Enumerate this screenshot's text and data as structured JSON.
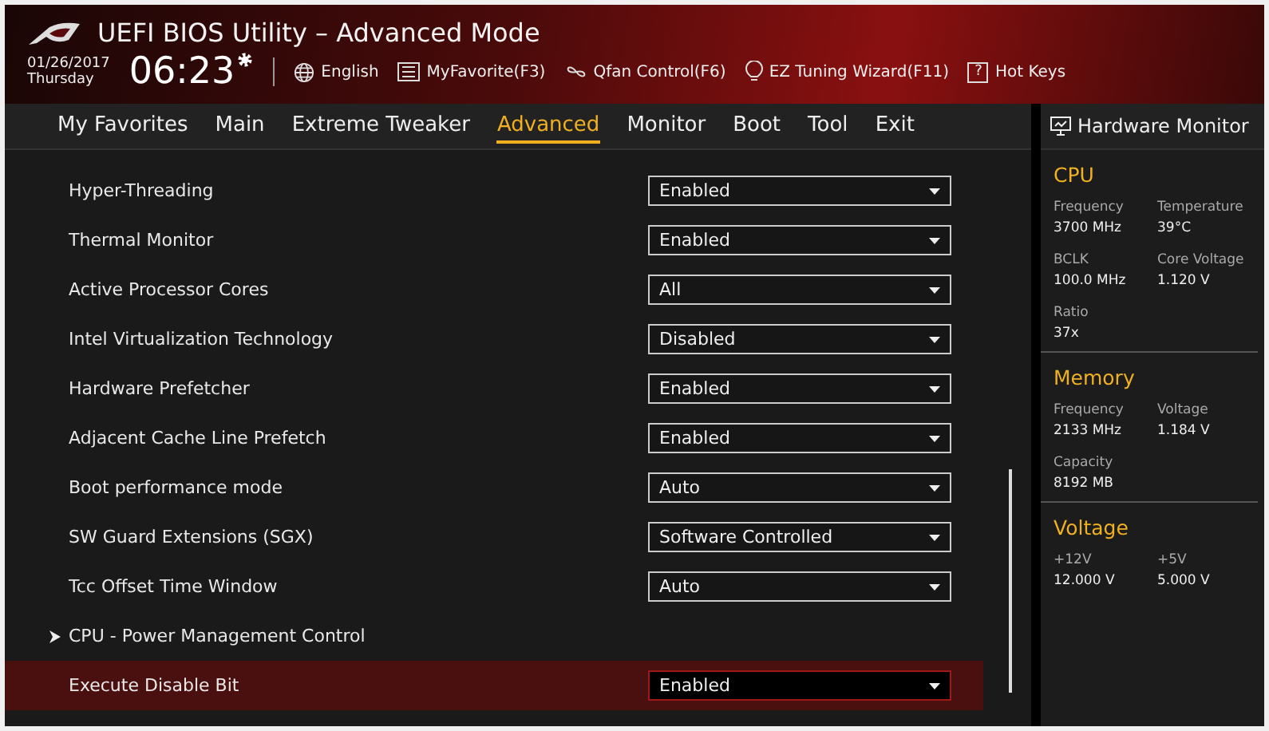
{
  "header": {
    "title": "UEFI BIOS Utility – Advanced Mode",
    "date": "01/26/2017",
    "day": "Thursday",
    "time": "06:23",
    "tools": [
      {
        "kind": "globe",
        "label": "English"
      },
      {
        "kind": "list",
        "label": "MyFavorite(F3)"
      },
      {
        "kind": "fan",
        "label": "Qfan Control(F6)"
      },
      {
        "kind": "bulb",
        "label": "EZ Tuning Wizard(F11)"
      },
      {
        "kind": "help",
        "icon": "?",
        "label": "Hot Keys"
      }
    ]
  },
  "tabs": [
    {
      "label": "My Favorites",
      "selected": false
    },
    {
      "label": "Main",
      "selected": false
    },
    {
      "label": "Extreme Tweaker",
      "selected": false
    },
    {
      "label": "Advanced",
      "selected": true
    },
    {
      "label": "Monitor",
      "selected": false
    },
    {
      "label": "Boot",
      "selected": false
    },
    {
      "label": "Tool",
      "selected": false
    },
    {
      "label": "Exit",
      "selected": false
    }
  ],
  "settings": [
    {
      "kind": "dropdown",
      "label": "Hyper-Threading",
      "value": "Enabled",
      "selected": false
    },
    {
      "kind": "dropdown",
      "label": "Thermal Monitor",
      "value": "Enabled",
      "selected": false
    },
    {
      "kind": "dropdown",
      "label": "Active Processor Cores",
      "value": "All",
      "selected": false
    },
    {
      "kind": "dropdown",
      "label": "Intel Virtualization Technology",
      "value": "Disabled",
      "selected": false
    },
    {
      "kind": "dropdown",
      "label": "Hardware Prefetcher",
      "value": "Enabled",
      "selected": false
    },
    {
      "kind": "dropdown",
      "label": "Adjacent Cache Line Prefetch",
      "value": "Enabled",
      "selected": false
    },
    {
      "kind": "dropdown",
      "label": "Boot performance mode",
      "value": "Auto",
      "selected": false
    },
    {
      "kind": "dropdown",
      "label": "SW Guard Extensions (SGX)",
      "value": "Software Controlled",
      "selected": false
    },
    {
      "kind": "dropdown",
      "label": "Tcc Offset Time Window",
      "value": "Auto",
      "selected": false
    },
    {
      "kind": "submenu",
      "label": "CPU - Power Management Control",
      "selected": false
    },
    {
      "kind": "dropdown",
      "label": "Execute Disable Bit",
      "value": "Enabled",
      "selected": true
    }
  ],
  "hardware_monitor": {
    "title": "Hardware Monitor",
    "sections": [
      {
        "title": "CPU",
        "readings": [
          {
            "label": "Frequency",
            "value": "3700 MHz"
          },
          {
            "label": "Temperature",
            "value": "39°C"
          },
          {
            "label": "BCLK",
            "value": "100.0 MHz"
          },
          {
            "label": "Core Voltage",
            "value": "1.120 V"
          },
          {
            "label": "Ratio",
            "value": "37x"
          }
        ]
      },
      {
        "title": "Memory",
        "readings": [
          {
            "label": "Frequency",
            "value": "2133 MHz"
          },
          {
            "label": "Voltage",
            "value": "1.184 V"
          },
          {
            "label": "Capacity",
            "value": "8192 MB"
          }
        ]
      },
      {
        "title": "Voltage",
        "readings": [
          {
            "label": "+12V",
            "value": "12.000 V"
          },
          {
            "label": "+5V",
            "value": "5.000 V"
          }
        ]
      }
    ]
  }
}
